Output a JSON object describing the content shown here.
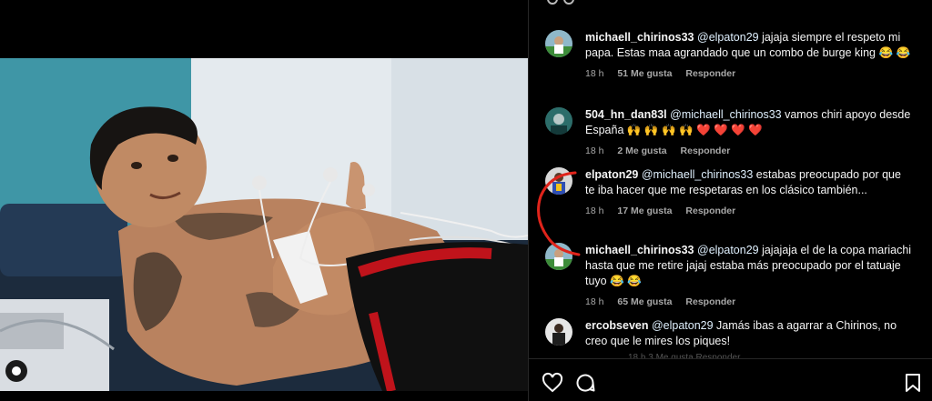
{
  "comments": [
    {
      "username": "michaell_chirinos33",
      "mention": "@elpaton29",
      "text": " jajaja siempre el respeto mi papa. Estas maa agrandado que un combo de burge king",
      "emoji": "😂 😂",
      "time": "18 h",
      "likes": "51 Me gusta",
      "reply": "Responder"
    },
    {
      "username": "504_hn_dan83l",
      "mention": "@michaell_chirinos33",
      "text": " vamos chiri apoyo desde España",
      "emoji": "🙌 🙌 🙌 🙌 ❤️ ❤️ ❤️ ❤️",
      "time": "18 h",
      "likes": "2 Me gusta",
      "reply": "Responder"
    },
    {
      "username": "elpaton29",
      "mention": "@michaell_chirinos33",
      "text": " estabas preocupado por que te iba hacer que me respetaras en los clásico también...",
      "emoji": "",
      "time": "18 h",
      "likes": "17 Me gusta",
      "reply": "Responder"
    },
    {
      "username": "michaell_chirinos33",
      "mention": "@elpaton29",
      "text": " jajajaja el de la copa mariachi hasta que me retire jajaj estaba más preocupado por el tatuaje tuyo",
      "emoji": "😂 😂",
      "time": "18 h",
      "likes": "65 Me gusta",
      "reply": "Responder"
    },
    {
      "username": "ercobseven",
      "mention": "@elpaton29",
      "text": " Jamás ibas a agarrar a Chirinos, no creo que le mires los piques!",
      "emoji": "",
      "time": "",
      "likes": "",
      "reply": ""
    }
  ],
  "peek_text": "18 h   3 Me gusta   Responder",
  "icons": {
    "like": "heart-icon",
    "comment": "comment-icon",
    "save": "bookmark-icon",
    "user": "user-icon"
  },
  "colors": {
    "background": "#000000",
    "secondary_text": "#a8a8a8",
    "annotation": "#e0241b"
  }
}
